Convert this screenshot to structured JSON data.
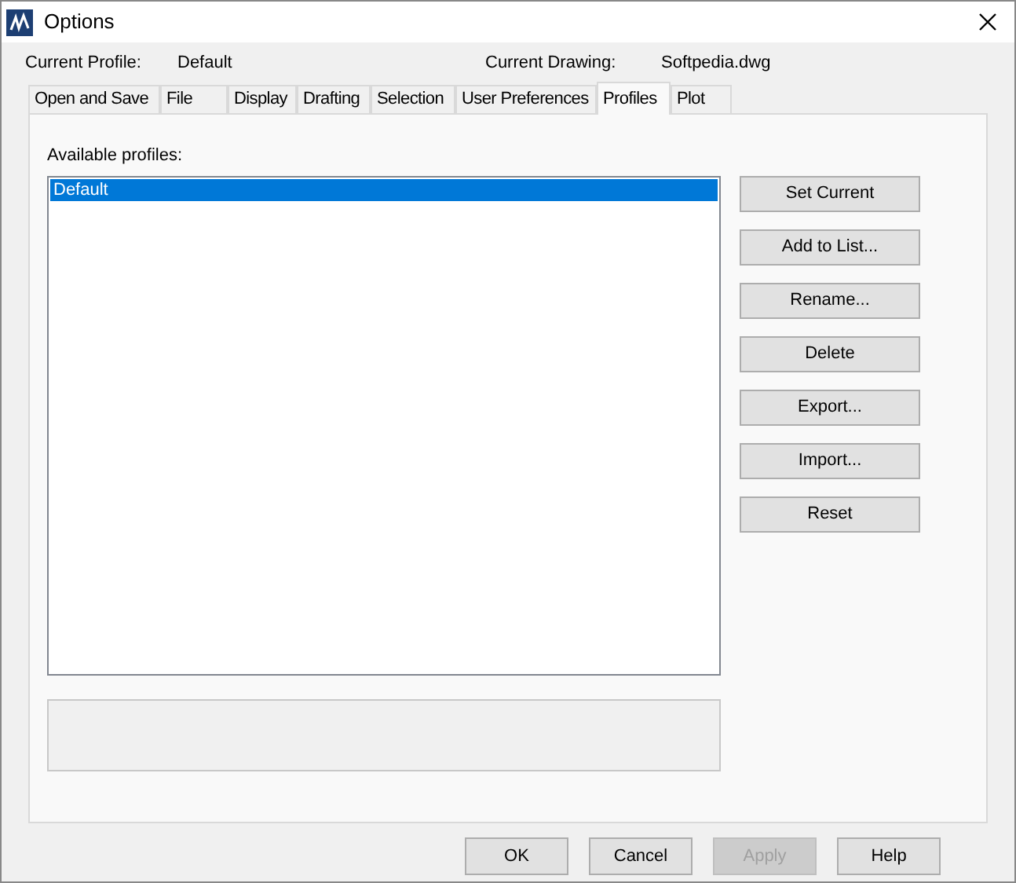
{
  "window": {
    "title": "Options"
  },
  "current_profile": {
    "label": "Current Profile:",
    "value": "Default"
  },
  "current_drawing": {
    "label": "Current Drawing:",
    "value": "Softpedia.dwg"
  },
  "tabs": [
    {
      "label": "Open and Save",
      "selected": false
    },
    {
      "label": "File",
      "selected": false
    },
    {
      "label": "Display",
      "selected": false
    },
    {
      "label": "Drafting",
      "selected": false
    },
    {
      "label": "Selection",
      "selected": false
    },
    {
      "label": "User Preferences",
      "selected": false
    },
    {
      "label": "Profiles",
      "selected": true
    },
    {
      "label": "Plot",
      "selected": false
    }
  ],
  "profiles": {
    "label": "Available profiles:",
    "items": [
      {
        "label": "Default",
        "selected": true
      }
    ]
  },
  "side_buttons": [
    {
      "label": "Set Current",
      "disabled": false
    },
    {
      "label": "Add to List...",
      "disabled": false
    },
    {
      "label": "Rename...",
      "disabled": false
    },
    {
      "label": "Delete",
      "disabled": false
    },
    {
      "label": "Export...",
      "disabled": false
    },
    {
      "label": "Import...",
      "disabled": false
    },
    {
      "label": "Reset",
      "disabled": false
    }
  ],
  "buttons": [
    {
      "label": "OK",
      "disabled": false
    },
    {
      "label": "Cancel",
      "disabled": false
    },
    {
      "label": "Apply",
      "disabled": true
    },
    {
      "label": "Help",
      "disabled": false
    }
  ]
}
